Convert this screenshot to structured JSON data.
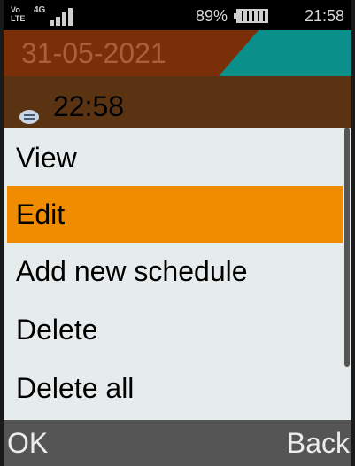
{
  "status_bar": {
    "volte_label": "Vo LTE",
    "network_label": "4G",
    "signal_bars": 4,
    "battery_percent": "89%",
    "battery_level": 0.89,
    "time": "21:58"
  },
  "date_header": {
    "date": "31-05-2021"
  },
  "event": {
    "icon": "message-bubble-icon",
    "time": "22:58"
  },
  "menu": {
    "items": [
      {
        "label": "View"
      },
      {
        "label": "Edit"
      },
      {
        "label": "Add new schedule"
      },
      {
        "label": "Delete"
      },
      {
        "label": "Delete all"
      }
    ],
    "selected_index": 1
  },
  "softkeys": {
    "left": "OK",
    "right": "Back"
  },
  "colors": {
    "date_band": "#7a2f08",
    "accent_teal": "#0b8f8a",
    "event_band": "#5a3312",
    "menu_bg": "#e6ecec",
    "selection": "#f08c00",
    "softkey_bar": "#555555"
  }
}
